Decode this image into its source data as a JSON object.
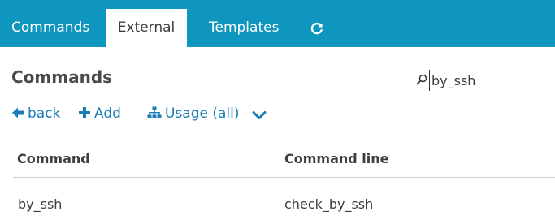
{
  "tabs": [
    {
      "label": "Commands",
      "active": false
    },
    {
      "label": "External",
      "active": true
    },
    {
      "label": "Templates",
      "active": false
    }
  ],
  "refresh_icon": "refresh-icon",
  "page": {
    "title": "Commands"
  },
  "search": {
    "value": "by_ssh",
    "icon": "search-icon"
  },
  "actions": {
    "back_label": "back",
    "add_label": "Add",
    "usage_label": "Usage (all)",
    "more_icon": "chevron-down-icon"
  },
  "table": {
    "columns": [
      "Command",
      "Command line"
    ],
    "rows": [
      {
        "command": "by_ssh",
        "command_line": "check_by_ssh"
      }
    ]
  },
  "colors": {
    "tabbar": "#0f96be",
    "link": "#1a7db8",
    "text": "#3d3d3d"
  }
}
